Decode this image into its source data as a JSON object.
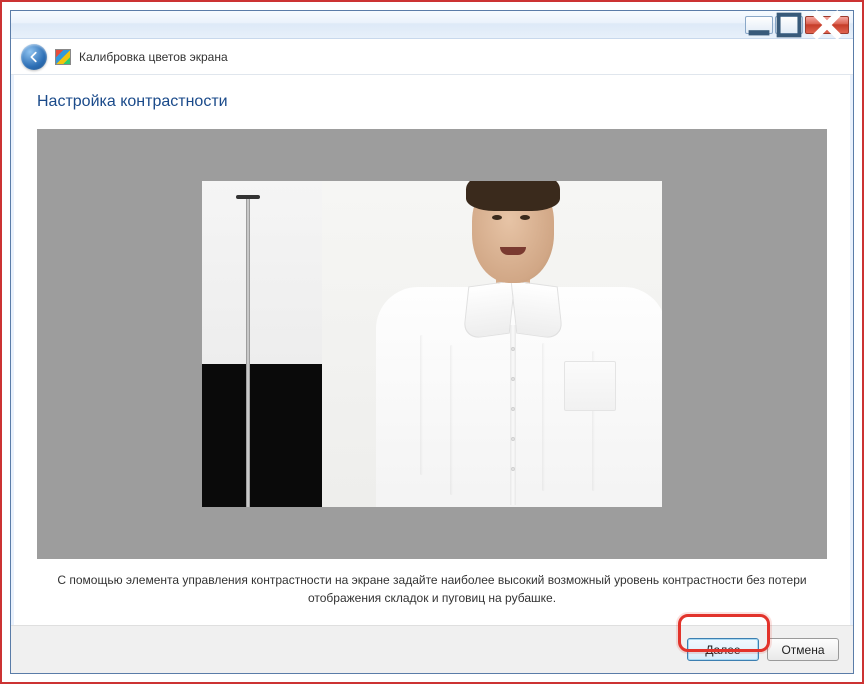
{
  "window": {
    "app_title": "Калибровка цветов экрана"
  },
  "page": {
    "title": "Настройка контрастности",
    "instruction": "С помощью элемента управления контрастности на экране задайте наиболее высокий возможный уровень контрастности без потери отображения складок и пуговиц на рубашке."
  },
  "buttons": {
    "next": "Далее",
    "cancel": "Отмена"
  },
  "icons": {
    "back": "back-arrow-icon",
    "minimize": "minimize-icon",
    "maximize": "maximize-icon",
    "close": "close-icon",
    "app": "color-calibration-icon"
  }
}
